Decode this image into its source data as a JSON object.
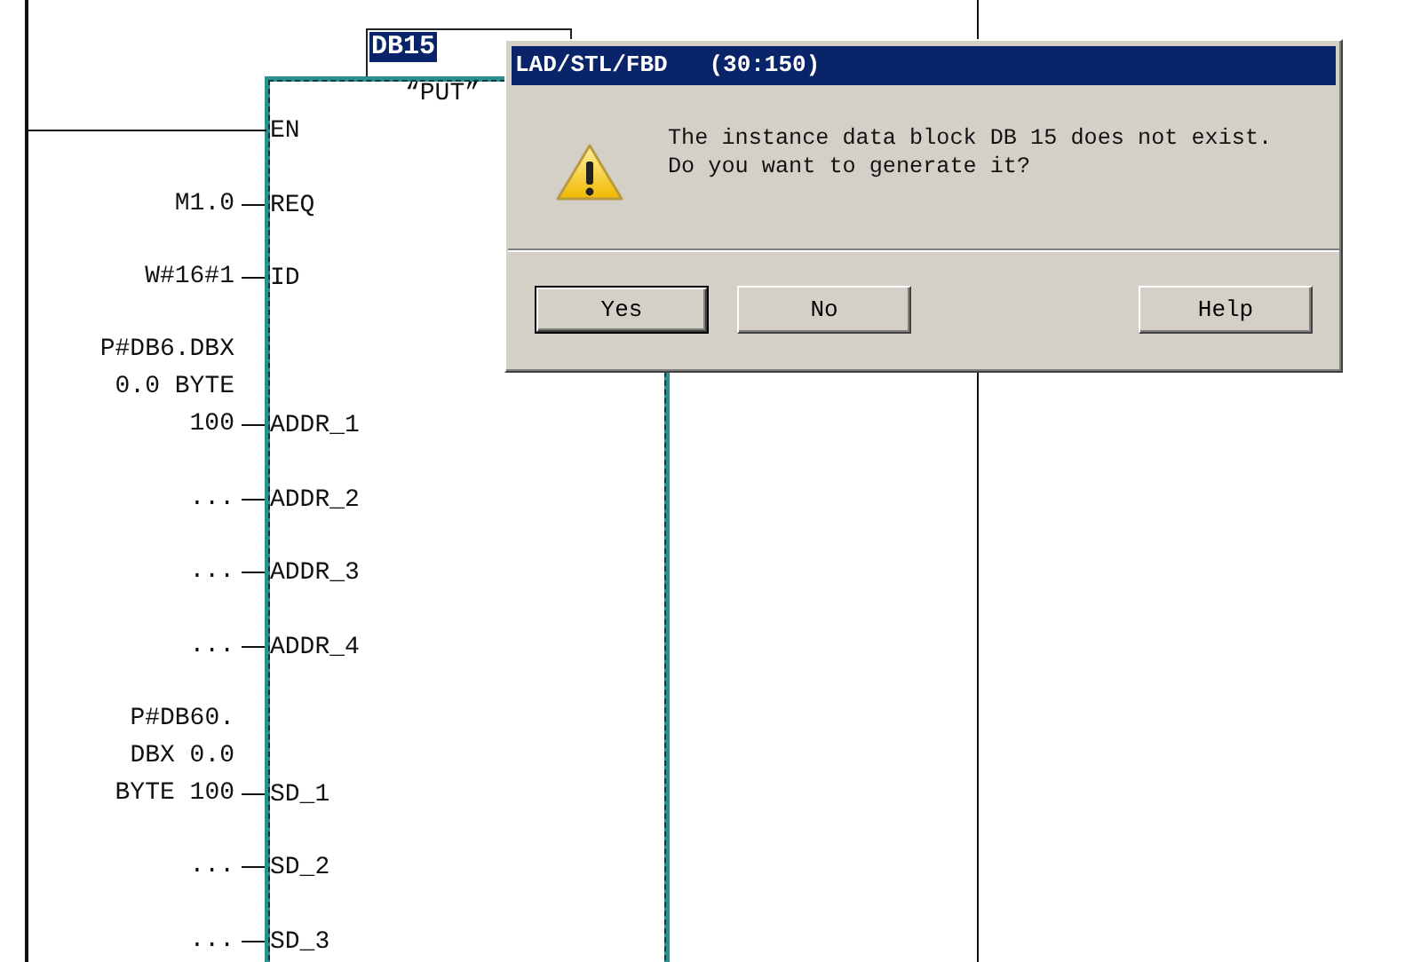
{
  "diagram": {
    "instance": {
      "text": "DB15",
      "selected": true
    },
    "block_name": "“PUT”",
    "pins": [
      {
        "name": "EN",
        "kind": "rail"
      },
      {
        "name": "REQ",
        "kind": "param",
        "param": [
          "M1.0"
        ]
      },
      {
        "name": "ID",
        "kind": "param",
        "param": [
          "W#16#1"
        ]
      },
      {
        "name": "ADDR_1",
        "kind": "param",
        "param": [
          "P#DB6.DBX",
          "0.0 BYTE",
          "100"
        ]
      },
      {
        "name": "ADDR_2",
        "kind": "param",
        "param": [
          "..."
        ]
      },
      {
        "name": "ADDR_3",
        "kind": "param",
        "param": [
          "..."
        ]
      },
      {
        "name": "ADDR_4",
        "kind": "param",
        "param": [
          "..."
        ]
      },
      {
        "name": "SD_1",
        "kind": "param",
        "param": [
          "P#DB60.",
          "DBX 0.0",
          "BYTE 100"
        ]
      },
      {
        "name": "SD_2",
        "kind": "param",
        "param": [
          "..."
        ]
      },
      {
        "name": "SD_3",
        "kind": "param",
        "param": [
          "..."
        ]
      }
    ]
  },
  "dialog": {
    "title": "LAD/STL/FBD   (30:150)",
    "message": [
      "The instance data block DB 15 does not exist.",
      "Do you want to generate it?"
    ],
    "buttons": [
      {
        "label": "Yes",
        "default": true
      },
      {
        "label": "No",
        "default": false
      },
      {
        "label": "Help",
        "default": false
      }
    ]
  }
}
